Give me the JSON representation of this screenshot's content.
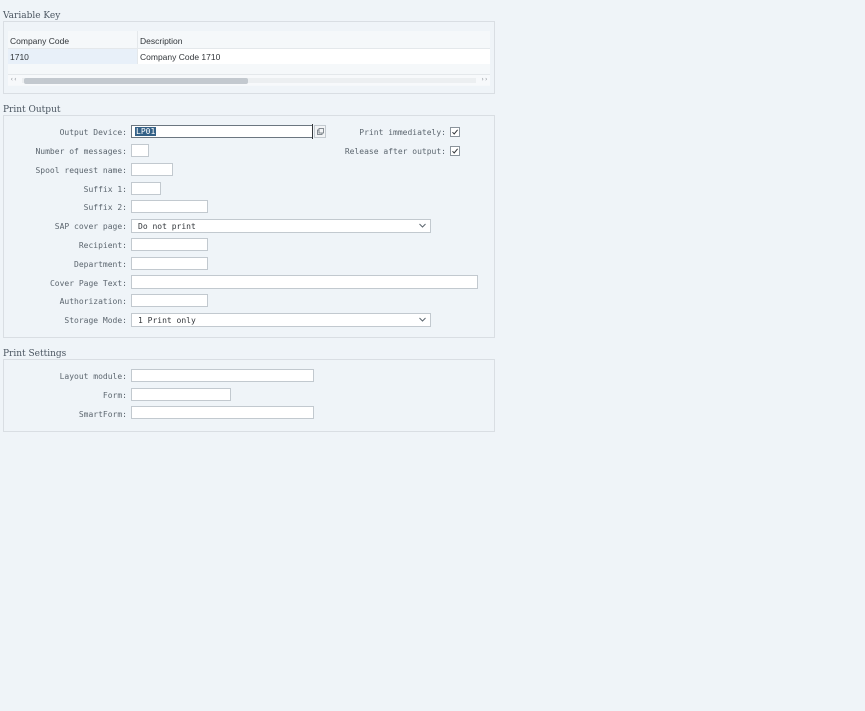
{
  "variable_key": {
    "title": "Variable Key",
    "columns": [
      "Company Code",
      "Description"
    ],
    "rows": [
      [
        "1710",
        "Company Code 1710"
      ]
    ]
  },
  "print_output": {
    "title": "Print Output",
    "output_device": {
      "label": "Output Device:",
      "value": "LP01"
    },
    "number_of_messages": {
      "label": "Number of messages:",
      "value": ""
    },
    "spool_request_name": {
      "label": "Spool request name:",
      "value": ""
    },
    "suffix1": {
      "label": "Suffix 1:",
      "value": ""
    },
    "suffix2": {
      "label": "Suffix 2:",
      "value": ""
    },
    "sap_cover_page": {
      "label": "SAP cover page:",
      "value": "Do not print"
    },
    "recipient": {
      "label": "Recipient:",
      "value": ""
    },
    "department": {
      "label": "Department:",
      "value": ""
    },
    "cover_page_text": {
      "label": "Cover Page Text:",
      "value": ""
    },
    "authorization": {
      "label": "Authorization:",
      "value": ""
    },
    "storage_mode": {
      "label": "Storage Mode:",
      "value": "1 Print only"
    },
    "print_immediately": {
      "label": "Print immediately:",
      "checked": true
    },
    "release_after_output": {
      "label": "Release after output:",
      "checked": true
    }
  },
  "print_settings": {
    "title": "Print Settings",
    "layout_module": {
      "label": "Layout module:",
      "value": ""
    },
    "form": {
      "label": "Form:",
      "value": ""
    },
    "smartform": {
      "label": "SmartForm:",
      "value": ""
    }
  },
  "icons": {
    "value_help": "value-help-icon",
    "dropdown": "chevron-down-icon",
    "check": "checkmark-icon"
  },
  "colors": {
    "background": "#eff4f8",
    "selection": "#346187",
    "border": "#c2c9cf"
  }
}
